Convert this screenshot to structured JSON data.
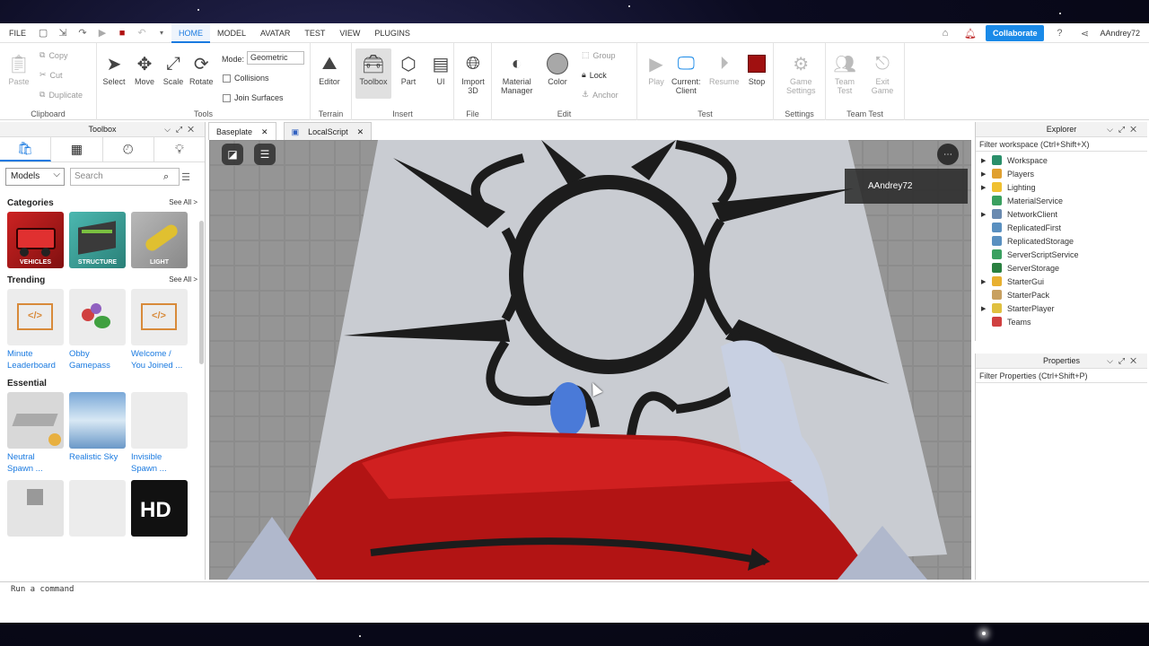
{
  "menubar": {
    "file": "FILE",
    "tabs": [
      "HOME",
      "MODEL",
      "AVATAR",
      "TEST",
      "VIEW",
      "PLUGINS"
    ],
    "collaborate": "Collaborate",
    "username": "AAndrey72"
  },
  "ribbon": {
    "clipboard": {
      "label": "Clipboard",
      "paste": "Paste",
      "copy": "Copy",
      "cut": "Cut",
      "duplicate": "Duplicate"
    },
    "tools": {
      "label": "Tools",
      "select": "Select",
      "move": "Move",
      "scale": "Scale",
      "rotate": "Rotate",
      "mode_label": "Mode:",
      "mode_value": "Geometric",
      "collisions": "Collisions",
      "join_surfaces": "Join Surfaces"
    },
    "terrain": {
      "label": "Terrain",
      "editor": "Editor"
    },
    "insert": {
      "label": "Insert",
      "toolbox": "Toolbox",
      "part": "Part",
      "ui": "UI"
    },
    "file": {
      "label": "File",
      "import3d": "Import\n3D"
    },
    "edit": {
      "label": "Edit",
      "material_manager": "Material\nManager",
      "color": "Color",
      "group": "Group",
      "lock": "Lock",
      "anchor": "Anchor"
    },
    "test": {
      "label": "Test",
      "play": "Play",
      "current_client": "Current:\nClient",
      "resume": "Resume",
      "stop": "Stop"
    },
    "settings": {
      "label": "Settings",
      "game_settings": "Game\nSettings"
    },
    "team_test": {
      "label": "Team Test",
      "team_test": "Team\nTest",
      "exit_game": "Exit\nGame"
    }
  },
  "toolbox": {
    "title": "Toolbox",
    "dropdown": "Models",
    "search_placeholder": "Search",
    "categories": {
      "title": "Categories",
      "see_all": "See All >",
      "items": [
        "VEHICLES",
        "STRUCTURE",
        "LIGHT"
      ]
    },
    "trending": {
      "title": "Trending",
      "see_all": "See All >",
      "items": [
        "Minute\nLeaderboard",
        "Obby\nGamepass",
        "Welcome /\nYou Joined ..."
      ]
    },
    "essential": {
      "title": "Essential",
      "items": [
        "Neutral\nSpawn ...",
        "Realistic Sky",
        "Invisible\nSpawn ..."
      ],
      "hd_text": "HD"
    }
  },
  "tabs": {
    "baseplate": "Baseplate",
    "localscript": "LocalScript"
  },
  "viewport": {
    "player_name": "AAndrey72"
  },
  "explorer": {
    "title": "Explorer",
    "filter": "Filter workspace (Ctrl+Shift+X)",
    "items": [
      {
        "name": "Workspace",
        "expandable": true,
        "color": "#2a8f6a"
      },
      {
        "name": "Players",
        "expandable": true,
        "color": "#e0a030"
      },
      {
        "name": "Lighting",
        "expandable": true,
        "color": "#f0c030"
      },
      {
        "name": "MaterialService",
        "expandable": false,
        "color": "#3aa060"
      },
      {
        "name": "NetworkClient",
        "expandable": true,
        "color": "#6a8ab0"
      },
      {
        "name": "ReplicatedFirst",
        "expandable": false,
        "color": "#5a90c0"
      },
      {
        "name": "ReplicatedStorage",
        "expandable": false,
        "color": "#5a90c0"
      },
      {
        "name": "ServerScriptService",
        "expandable": false,
        "color": "#3aa060"
      },
      {
        "name": "ServerStorage",
        "expandable": false,
        "color": "#2a8040"
      },
      {
        "name": "StarterGui",
        "expandable": true,
        "color": "#e8b030"
      },
      {
        "name": "StarterPack",
        "expandable": false,
        "color": "#c8a060"
      },
      {
        "name": "StarterPlayer",
        "expandable": true,
        "color": "#e0c040"
      },
      {
        "name": "Teams",
        "expandable": false,
        "color": "#d04040"
      }
    ]
  },
  "properties": {
    "title": "Properties",
    "filter": "Filter Properties (Ctrl+Shift+P)"
  },
  "command_bar": {
    "placeholder": "Run a command"
  }
}
